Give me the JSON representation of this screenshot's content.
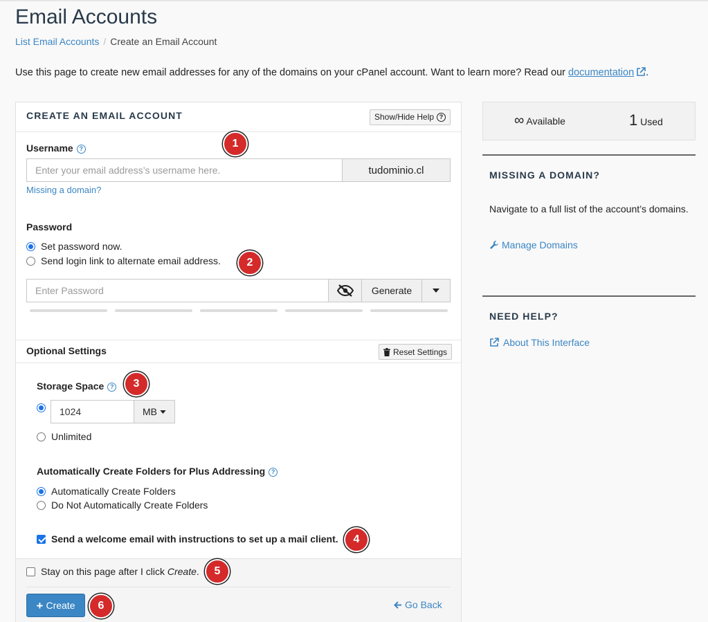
{
  "page": {
    "title": "Email Accounts",
    "breadcrumb_link": "List Email Accounts",
    "breadcrumb_current": "Create an Email Account",
    "intro_text": "Use this page to create new email addresses for any of the domains on your cPanel account. Want to learn more? Read our",
    "intro_link": "documentation",
    "intro_end": "."
  },
  "form": {
    "title": "CREATE AN EMAIL ACCOUNT",
    "help_toggle": "Show/Hide Help",
    "username_label": "Username",
    "username_placeholder": "Enter your email address’s username here.",
    "domain": "tudominio.cl",
    "missing_domain_link": "Missing a domain?",
    "password_label": "Password",
    "password_opt_now": "Set password now.",
    "password_opt_link": "Send login link to alternate email address.",
    "password_placeholder": "Enter Password",
    "generate_label": "Generate",
    "optional_title": "Optional Settings",
    "reset_label": "Reset Settings",
    "storage_label": "Storage Space",
    "storage_value": "1024",
    "storage_unit": "MB",
    "storage_unlimited": "Unlimited",
    "plus_label": "Automatically Create Folders for Plus Addressing",
    "plus_opt_auto": "Automatically Create Folders",
    "plus_opt_none": "Do Not Automatically Create Folders",
    "welcome_label": "Send a welcome email with instructions to set up a mail client.",
    "stay_prefix": "Stay on this page after I click ",
    "stay_em": "Create",
    "stay_suffix": ".",
    "create_label": "Create",
    "go_back_label": "Go Back"
  },
  "annotations": [
    "1",
    "2",
    "3",
    "4",
    "5",
    "6"
  ],
  "stats": {
    "available_symbol": "∞",
    "available_label": "Available",
    "used_count": "1",
    "used_label": "Used"
  },
  "sidebar": {
    "missing_title": "MISSING A DOMAIN?",
    "missing_text": "Navigate to a full list of the account’s domains.",
    "manage_link": "Manage Domains",
    "help_title": "NEED HELP?",
    "about_link": "About This Interface"
  },
  "colors": {
    "link": "#3b86c4",
    "badge": "#d42a2a",
    "primary": "#3b86c4"
  }
}
